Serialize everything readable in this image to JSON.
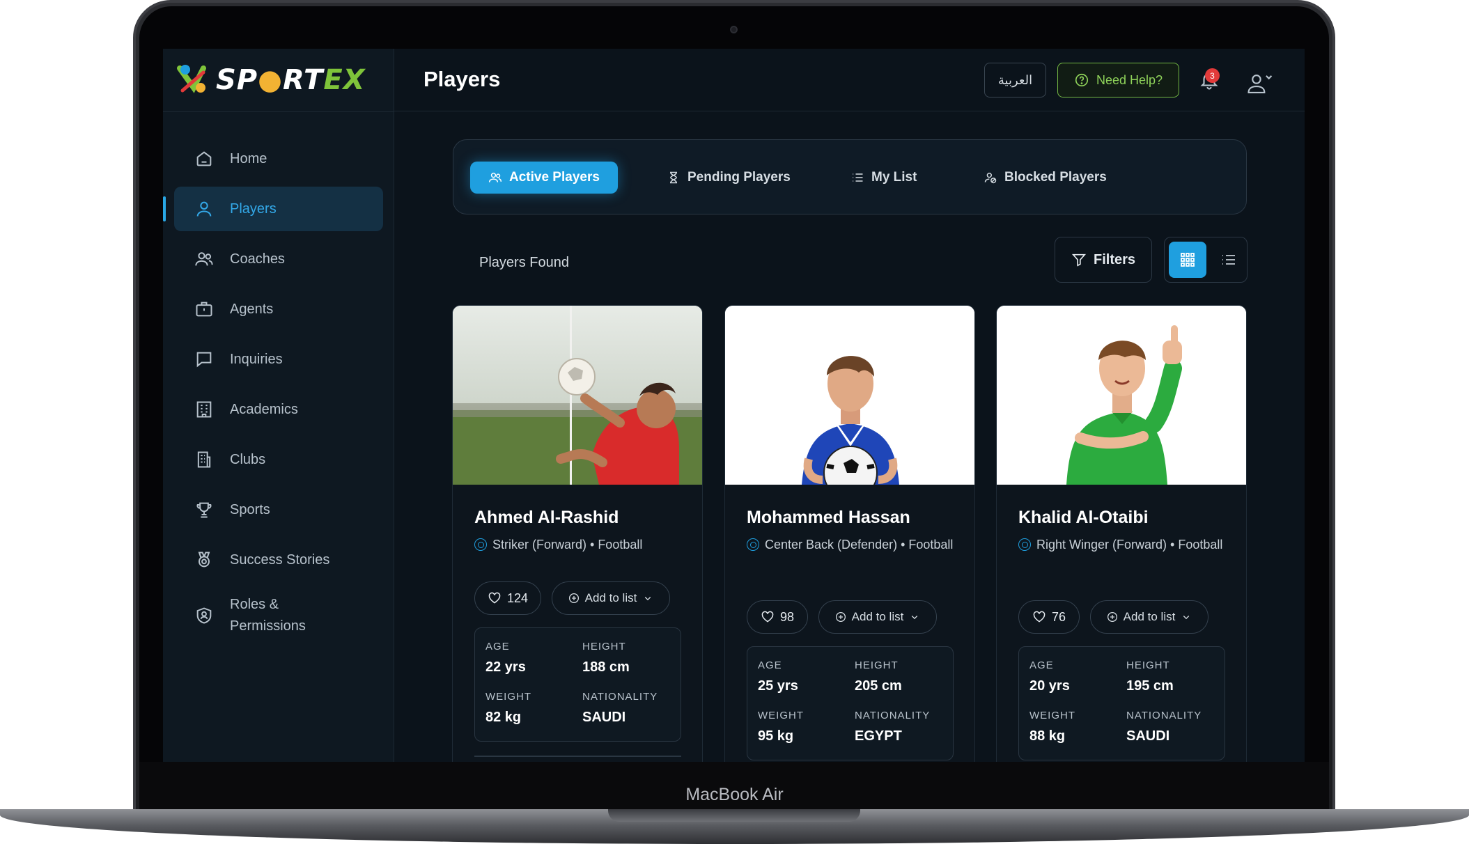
{
  "device": {
    "label": "MacBook Air"
  },
  "app": {
    "logo": {
      "text_main": "SP",
      "text_mid": "RT",
      "text_accent": "EX",
      "letter_o": "●"
    },
    "sidebar": {
      "items": [
        {
          "label": "Home",
          "icon": "home-icon"
        },
        {
          "label": "Players",
          "icon": "user-icon",
          "active": true
        },
        {
          "label": "Coaches",
          "icon": "users-icon"
        },
        {
          "label": "Agents",
          "icon": "briefcase-icon"
        },
        {
          "label": "Inquiries",
          "icon": "chat-icon"
        },
        {
          "label": "Academics",
          "icon": "building-icon"
        },
        {
          "label": "Clubs",
          "icon": "office-icon"
        },
        {
          "label": "Sports",
          "icon": "trophy-icon"
        },
        {
          "label": "Success Stories",
          "icon": "medal-icon"
        },
        {
          "label": "Roles &",
          "label2": "Permissions",
          "icon": "shield-user-icon"
        }
      ]
    },
    "header": {
      "title": "Players",
      "language_button": "العربية",
      "help_button": "Need Help?",
      "notification_count": "3"
    },
    "tabs": [
      {
        "label": "Active Players",
        "icon": "users-icon",
        "active": true
      },
      {
        "label": "Pending Players",
        "icon": "hourglass-icon"
      },
      {
        "label": "My List",
        "icon": "list-icon"
      },
      {
        "label": "Blocked Players",
        "icon": "user-blocked-icon"
      }
    ],
    "toolbar": {
      "found_label": "Players Found",
      "filters_label": "Filters",
      "view_mode": "grid"
    },
    "stat_labels": {
      "age": "AGE",
      "height": "HEIGHT",
      "weight": "WEIGHT",
      "nationality": "NATIONALITY"
    },
    "players": [
      {
        "name": "Ahmed Al-Rashid",
        "position": "Striker (Forward) • Football",
        "likes": "124",
        "add_to_list": "Add to list",
        "age": "22 yrs",
        "height": "188 cm",
        "weight": "82 kg",
        "nationality": "SAUDI"
      },
      {
        "name": "Mohammed Hassan",
        "position": "Center Back (Defender) • Football",
        "likes": "98",
        "add_to_list": "Add to list",
        "age": "25 yrs",
        "height": "205 cm",
        "weight": "95 kg",
        "nationality": "EGYPT"
      },
      {
        "name": "Khalid Al-Otaibi",
        "position": "Right Winger (Forward) • Football",
        "likes": "76",
        "add_to_list": "Add to list",
        "age": "20 yrs",
        "height": "195 cm",
        "weight": "88 kg",
        "nationality": "SAUDI"
      }
    ],
    "colors": {
      "accent": "#1f9fdf",
      "help": "#8fd35a",
      "background": "#0b131b",
      "sidebar": "#0e1821"
    }
  }
}
